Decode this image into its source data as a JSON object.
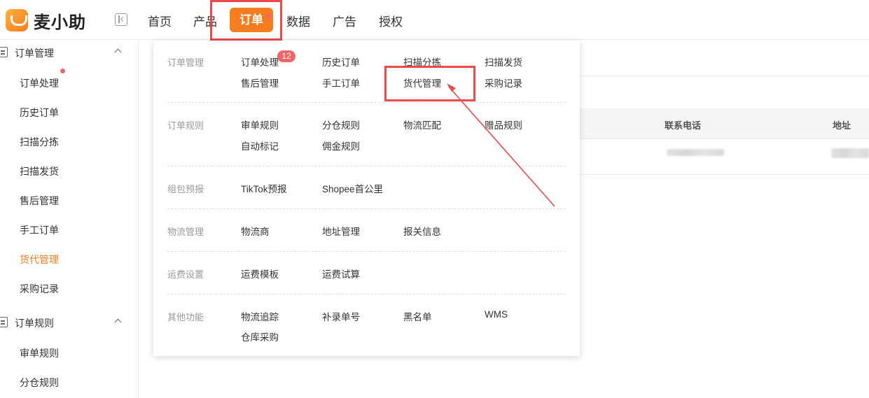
{
  "app": {
    "name": "麦小助"
  },
  "nav": {
    "items": [
      "首页",
      "产品",
      "数据",
      "广告",
      "授权"
    ],
    "active": "订单"
  },
  "sidebar": {
    "groups": [
      {
        "label": "订单管理",
        "items": [
          "订单处理",
          "历史订单",
          "扫描分拣",
          "扫描发货",
          "售后管理",
          "手工订单",
          "货代管理",
          "采购记录"
        ]
      },
      {
        "label": "订单规则",
        "items": [
          "审单规则",
          "分仓规则"
        ]
      }
    ],
    "active_item": "货代管理"
  },
  "table": {
    "headers": [
      "联系电话",
      "地址"
    ]
  },
  "dropdown": {
    "sections": [
      {
        "label": "订单管理",
        "items": [
          "订单处理",
          "历史订单",
          "扫描分拣",
          "扫描发货",
          "售后管理",
          "手工订单",
          "货代管理",
          "采购记录"
        ]
      },
      {
        "label": "订单规则",
        "items": [
          "审单规则",
          "分仓规则",
          "物流匹配",
          "赠品规则",
          "自动标记",
          "佣金规则"
        ]
      },
      {
        "label": "组包预报",
        "items": [
          "TikTok预报",
          "Shopee首公里"
        ]
      },
      {
        "label": "物流管理",
        "items": [
          "物流商",
          "地址管理",
          "报关信息"
        ]
      },
      {
        "label": "运费设置",
        "items": [
          "运费模板",
          "运费试算"
        ]
      },
      {
        "label": "其他功能",
        "items": [
          "物流追踪",
          "补录单号",
          "黑名单",
          "WMS",
          "仓库采购"
        ]
      }
    ],
    "badge_count": "12"
  },
  "colors": {
    "accent": "#f57c1f",
    "highlight": "#e94b4b",
    "badge": "#f06565"
  }
}
